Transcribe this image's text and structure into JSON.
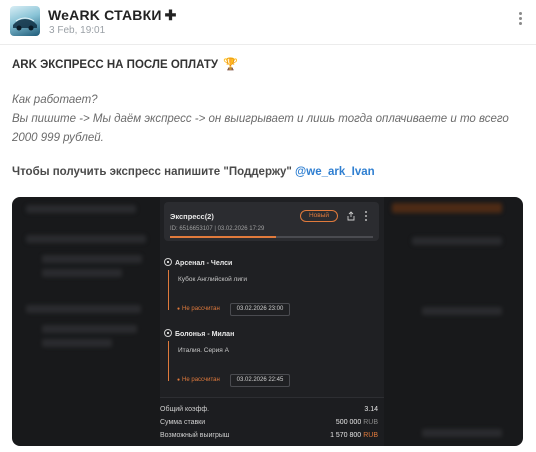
{
  "channel": {
    "name": "WeARK СТАВКИ",
    "cross_glyph": "✚",
    "date": "3 Feb, 19:01"
  },
  "post": {
    "heading": "ARK ЭКСПРЕСС НА ПОСЛЕ ОПЛАТУ",
    "trophy_glyph": "🏆",
    "question": "Как работает?",
    "explanation": "Вы пишите -> Мы даём экспресс -> он выигрывает и лишь тогда оплачиваете и то всего 2000 999 рублей.",
    "cta_text": "Чтобы получить экспресс напишите \"Поддержу\"",
    "cta_link": "@we_ark_Ivan"
  },
  "bet_slip": {
    "title": "Экспресс(2)",
    "id_line": "ID: 6516653107  |  03.02.2026 17:29",
    "badge": "Новый",
    "progress": 0.52,
    "matches": [
      {
        "teams": "Арсенал - Челси",
        "league": "Кубок Английской лиги",
        "status": "Не рассчитан",
        "time": "03.02.2026 23:00"
      },
      {
        "teams": "Болонья - Милан",
        "league": "Италия. Серия А",
        "status": "Не рассчитан",
        "time": "03.02.2026 22:45"
      }
    ],
    "summary": {
      "odds_label": "Общий коэфф.",
      "odds_value": "3.14",
      "stake_label": "Сумма ставки",
      "stake_value": "500 000",
      "stake_currency": "RUB",
      "win_label": "Возможный выигрыш",
      "win_value": "1 570 800",
      "win_currency": "RUB"
    }
  },
  "colors": {
    "accent_orange": "#e07a3c",
    "link_blue": "#2f7fd1",
    "dark_bg": "#1f2023"
  }
}
